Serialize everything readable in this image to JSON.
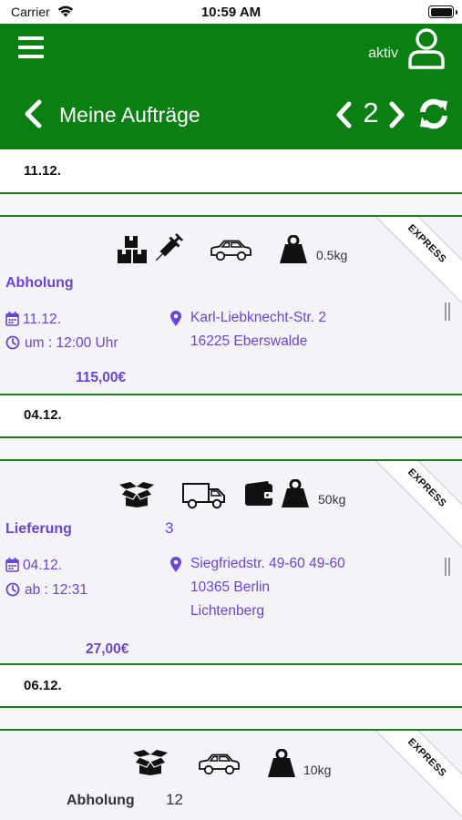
{
  "status_bar": {
    "carrier": "Carrier",
    "time": "10:59 AM"
  },
  "header": {
    "status": "aktiv",
    "title": "Meine Aufträge",
    "page_number": "2"
  },
  "groups": [
    {
      "date": "11.12.",
      "order": {
        "badge": "EXPRESS",
        "weight": "0.5kg",
        "type": "Abholung",
        "count": "",
        "date": "11.12.",
        "time": "um : 12:00 Uhr",
        "address_lines": [
          "Karl-Liebknecht-Str. 2",
          "16225 Eberswalde"
        ],
        "price": "115,00€"
      }
    },
    {
      "date": "04.12.",
      "order": {
        "badge": "EXPRESS",
        "weight": "50kg",
        "type": "Lieferung",
        "count": "3",
        "date": "04.12.",
        "time": "ab : 12:31",
        "address_lines": [
          "Siegfriedstr. 49-60 49-60",
          "10365 Berlin",
          "Lichtenberg"
        ],
        "price": "27,00€"
      }
    },
    {
      "date": "06.12.",
      "order": {
        "badge": "EXPRESS",
        "weight": "10kg",
        "type": "Abholung",
        "count": "12"
      }
    }
  ],
  "colors": {
    "header_green": "#0a7f12",
    "accent_purple": "#6a45d8",
    "divider_green": "#1c7f1c"
  },
  "icons": [
    "menu-icon",
    "user-icon",
    "chevron-left-icon",
    "chevron-right-icon",
    "refresh-icon",
    "boxes-icon",
    "syringe-icon",
    "car-icon",
    "truck-icon",
    "wallet-icon",
    "weight-icon",
    "open-box-icon",
    "calendar-icon",
    "clock-icon",
    "location-pin-icon"
  ]
}
